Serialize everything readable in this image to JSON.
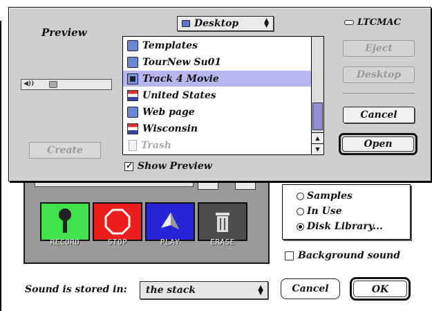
{
  "open_dialog": {
    "preview_title": "Preview",
    "create_label": "Create",
    "location": "Desktop",
    "disk_name": "LTCMAC",
    "buttons": {
      "eject": "Eject",
      "desktop": "Desktop",
      "cancel": "Cancel",
      "open": "Open"
    },
    "show_preview": {
      "label": "Show Preview",
      "checked": true
    },
    "files": [
      {
        "name": "Templates",
        "icon": "folder-icon",
        "selected": false,
        "dim": false
      },
      {
        "name": "TourNew Su01",
        "icon": "folder-icon",
        "selected": false,
        "dim": false
      },
      {
        "name": "Track 4 Movie",
        "icon": "movie-file-icon",
        "selected": true,
        "dim": false
      },
      {
        "name": "United States",
        "icon": "flag-icon",
        "selected": false,
        "dim": false
      },
      {
        "name": "Web page",
        "icon": "folder-icon",
        "selected": false,
        "dim": false
      },
      {
        "name": "Wisconsin",
        "icon": "flag-icon",
        "selected": false,
        "dim": false
      },
      {
        "name": "Trash",
        "icon": "trash-icon",
        "selected": false,
        "dim": true
      }
    ]
  },
  "sound_dialog": {
    "buttons": [
      {
        "label": "RECORD",
        "icon": "microphone-icon",
        "color": "#3fe24a"
      },
      {
        "label": "STOP",
        "icon": "stop-octagon-icon",
        "color": "#ee1d1d"
      },
      {
        "label": "PLAY",
        "icon": "play-icon",
        "color": "#2626d8"
      },
      {
        "label": "ERASE",
        "icon": "trash-can-icon",
        "color": "#4d4d4d"
      }
    ],
    "sources": [
      {
        "label": "Samples",
        "selected": false
      },
      {
        "label": "In Use",
        "selected": false
      },
      {
        "label": "Disk Library...",
        "selected": true
      }
    ],
    "background_sound": {
      "label": "Background sound",
      "checked": false
    },
    "stored_label": "Sound is stored in:",
    "stored_value": "the stack",
    "cancel_label": "Cancel",
    "ok_label": "OK"
  }
}
